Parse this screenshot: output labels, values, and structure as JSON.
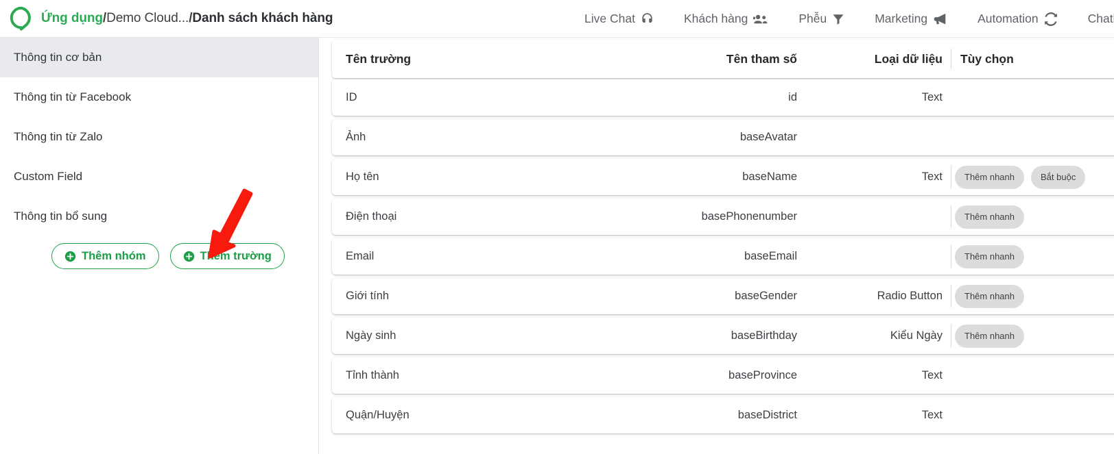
{
  "brand": {
    "logo_icon": "chat-bubble-logo",
    "logo_color": "#2aab52"
  },
  "breadcrumb": {
    "app": "Ứng dụng",
    "sep1": "/",
    "middle": "Demo Cloud...",
    "sep2": "/ ",
    "current": "Danh sách khách hàng"
  },
  "topnav": {
    "items": [
      {
        "label": "Live Chat",
        "icon": "headset-icon"
      },
      {
        "label": "Khách hàng",
        "icon": "users-icon"
      },
      {
        "label": "Phễu",
        "icon": "funnel-icon"
      },
      {
        "label": "Marketing",
        "icon": "megaphone-icon"
      },
      {
        "label": "Automation",
        "icon": "sync-icon"
      },
      {
        "label": "Chatbo",
        "icon": "none"
      }
    ]
  },
  "sidebar": {
    "items": [
      {
        "label": "Thông tin cơ bản",
        "active": true
      },
      {
        "label": "Thông tin từ Facebook",
        "active": false
      },
      {
        "label": "Thông tin từ Zalo",
        "active": false
      },
      {
        "label": "Custom Field",
        "active": false
      },
      {
        "label": "Thông tin bổ sung",
        "active": false
      }
    ],
    "actions": [
      {
        "label": "Thêm nhóm",
        "icon": "plus-circle-icon"
      },
      {
        "label": "Thêm trường",
        "icon": "plus-circle-icon"
      }
    ],
    "accent_color": "#1b9e46",
    "active_bg": "#e8eaed"
  },
  "annotation": {
    "type": "red-arrow",
    "color": "#f81b0d",
    "points_to": "Thêm trường"
  },
  "table": {
    "columns": [
      "Tên trường",
      "Tên tham số",
      "Loại dữ liệu",
      "Tùy chọn"
    ],
    "rows": [
      {
        "name": "ID",
        "param": "id",
        "type": "Text",
        "options": []
      },
      {
        "name": "Ảnh",
        "param": "baseAvatar",
        "type": "",
        "options": []
      },
      {
        "name": "Họ tên",
        "param": "baseName",
        "type": "Text",
        "options": [
          "Thêm nhanh",
          "Bắt buộc"
        ]
      },
      {
        "name": "Điện thoại",
        "param": "basePhonenumber",
        "type": "",
        "options": [
          "Thêm nhanh"
        ]
      },
      {
        "name": "Email",
        "param": "baseEmail",
        "type": "",
        "options": [
          "Thêm nhanh"
        ]
      },
      {
        "name": "Giới tính",
        "param": "baseGender",
        "type": "Radio Button",
        "options": [
          "Thêm nhanh"
        ]
      },
      {
        "name": "Ngày sinh",
        "param": "baseBirthday",
        "type": "Kiểu Ngày",
        "options": [
          "Thêm nhanh"
        ]
      },
      {
        "name": "Tỉnh thành",
        "param": "baseProvince",
        "type": "Text",
        "options": []
      },
      {
        "name": "Quận/Huyện",
        "param": "baseDistrict",
        "type": "Text",
        "options": []
      }
    ],
    "chip_bg": "#dcdcdc"
  }
}
